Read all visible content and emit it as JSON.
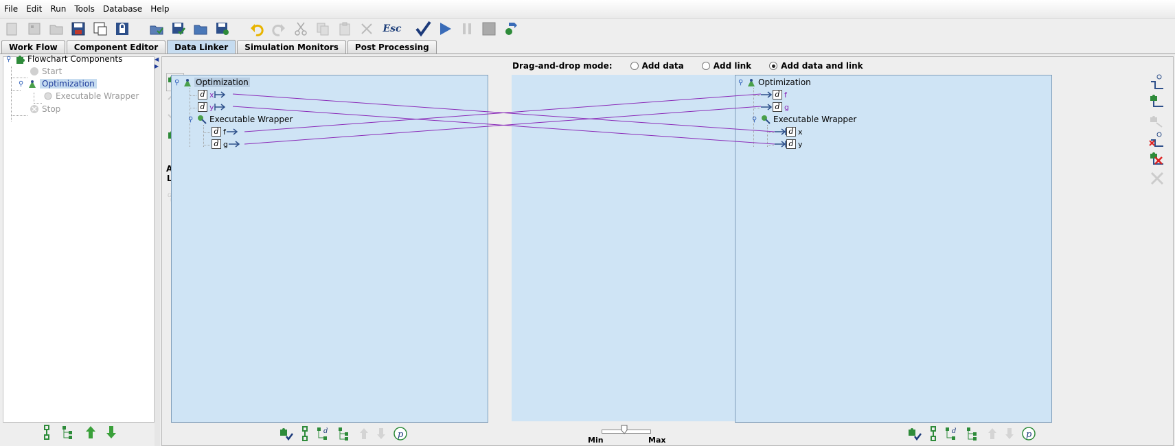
{
  "menu": [
    "File",
    "Edit",
    "Run",
    "Tools",
    "Database",
    "Help"
  ],
  "toolbar": {
    "esc_label": "Esc",
    "icons": [
      "new-icon",
      "component-icon",
      "open-folder-icon",
      "save-icon",
      "save-as-icon",
      "lock-icon",
      "export-icon",
      "save-check-icon",
      "folder-icon",
      "save-component-icon",
      "undo-icon",
      "redo-icon",
      "cut-icon",
      "copy-icon",
      "paste-icon",
      "delete-icon",
      "esc-icon",
      "validate-icon",
      "run-icon",
      "pause-icon",
      "stop-icon",
      "run-component-icon"
    ]
  },
  "tabs": [
    {
      "label": "Work Flow",
      "active": false
    },
    {
      "label": "Component Editor",
      "active": false
    },
    {
      "label": "Data Linker",
      "active": true
    },
    {
      "label": "Simulation Monitors",
      "active": false
    },
    {
      "label": "Post Processing",
      "active": false
    }
  ],
  "flowchart_tree": {
    "root": "Flowchart Components",
    "items": [
      {
        "label": "Start",
        "state": "disabled"
      },
      {
        "label": "Optimization",
        "state": "selected"
      },
      {
        "label": "Executable Wrapper",
        "state": "disabled"
      },
      {
        "label": "Stop",
        "state": "disabled"
      }
    ]
  },
  "dnd": {
    "label": "Drag-and-drop mode:",
    "options": [
      {
        "label": "Add data",
        "checked": false
      },
      {
        "label": "Add link",
        "checked": false
      },
      {
        "label": "Add data and link",
        "checked": true
      }
    ]
  },
  "auto_link": {
    "label_line1": "Auto",
    "label_line2": "Link",
    "checked": true
  },
  "left_pane": {
    "root": "Optimization",
    "vars": [
      "x",
      "y"
    ],
    "child": "Executable Wrapper",
    "child_vars": [
      "f",
      "g"
    ]
  },
  "right_pane": {
    "root": "Optimization",
    "vars": [
      "f",
      "g"
    ],
    "child": "Executable Wrapper",
    "child_vars": [
      "x",
      "y"
    ]
  },
  "links": [
    {
      "from": "Optimization.x",
      "to": "Executable Wrapper.x"
    },
    {
      "from": "Optimization.y",
      "to": "Executable Wrapper.y"
    },
    {
      "from": "Executable Wrapper.f",
      "to": "Optimization.f"
    },
    {
      "from": "Executable Wrapper.g",
      "to": "Optimization.g"
    }
  ],
  "slider": {
    "min_label": "Min",
    "max_label": "Max"
  },
  "colors": {
    "pane_bg": "#cfe4f5",
    "link_line": "#8a2ab8",
    "selection": "#c6dcf0",
    "arrow": "#1c3a9a"
  }
}
